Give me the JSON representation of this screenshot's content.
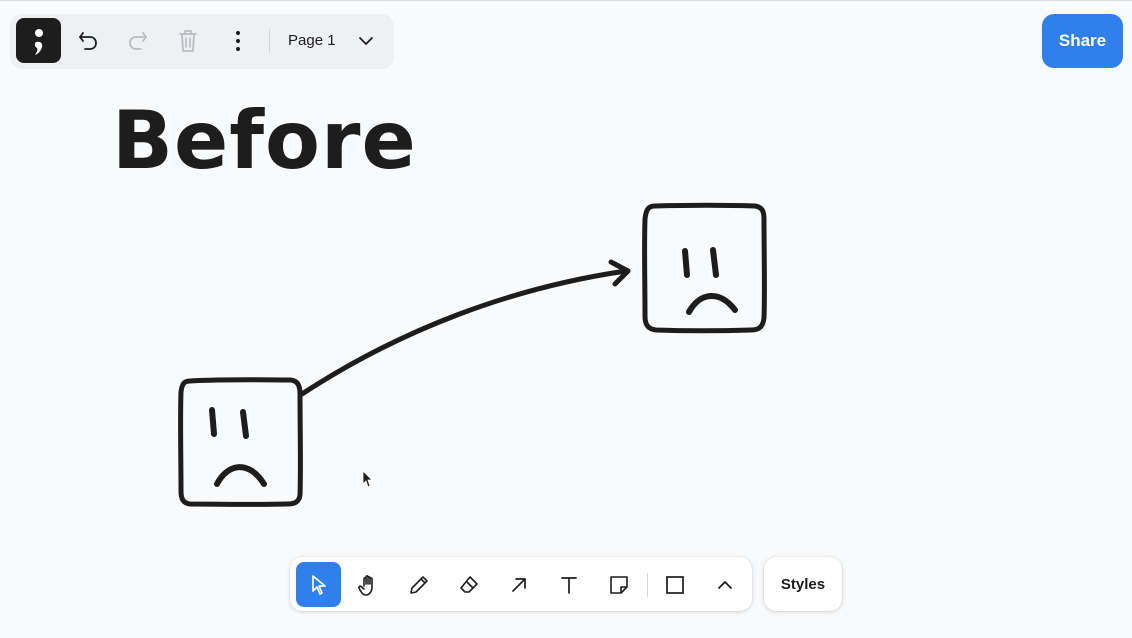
{
  "toolbar": {
    "page_label": "Page 1",
    "share_label": "Share"
  },
  "canvas": {
    "heading_text": "Before"
  },
  "bottom_toolbar": {
    "styles_label": "Styles",
    "active_tool": "select",
    "tools": [
      "select",
      "hand",
      "draw",
      "eraser",
      "arrow",
      "text",
      "note",
      "rectangle",
      "more"
    ]
  },
  "colors": {
    "accent": "#2f80ed",
    "ink": "#1d1d1d",
    "background": "#f9fafb",
    "panel": "#eef0f3"
  }
}
